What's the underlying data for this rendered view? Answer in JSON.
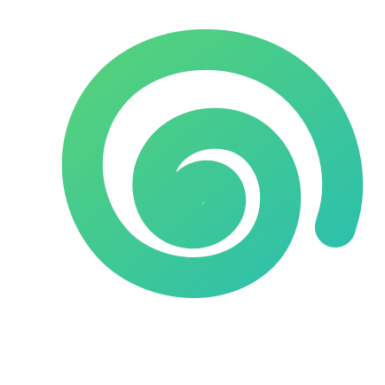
{
  "logo": {
    "name": "spiral-logo",
    "icon": "spiral-icon",
    "colors": {
      "background": "#ffffff",
      "gradient_start": "#56d27a",
      "gradient_end": "#2bbfae"
    }
  }
}
